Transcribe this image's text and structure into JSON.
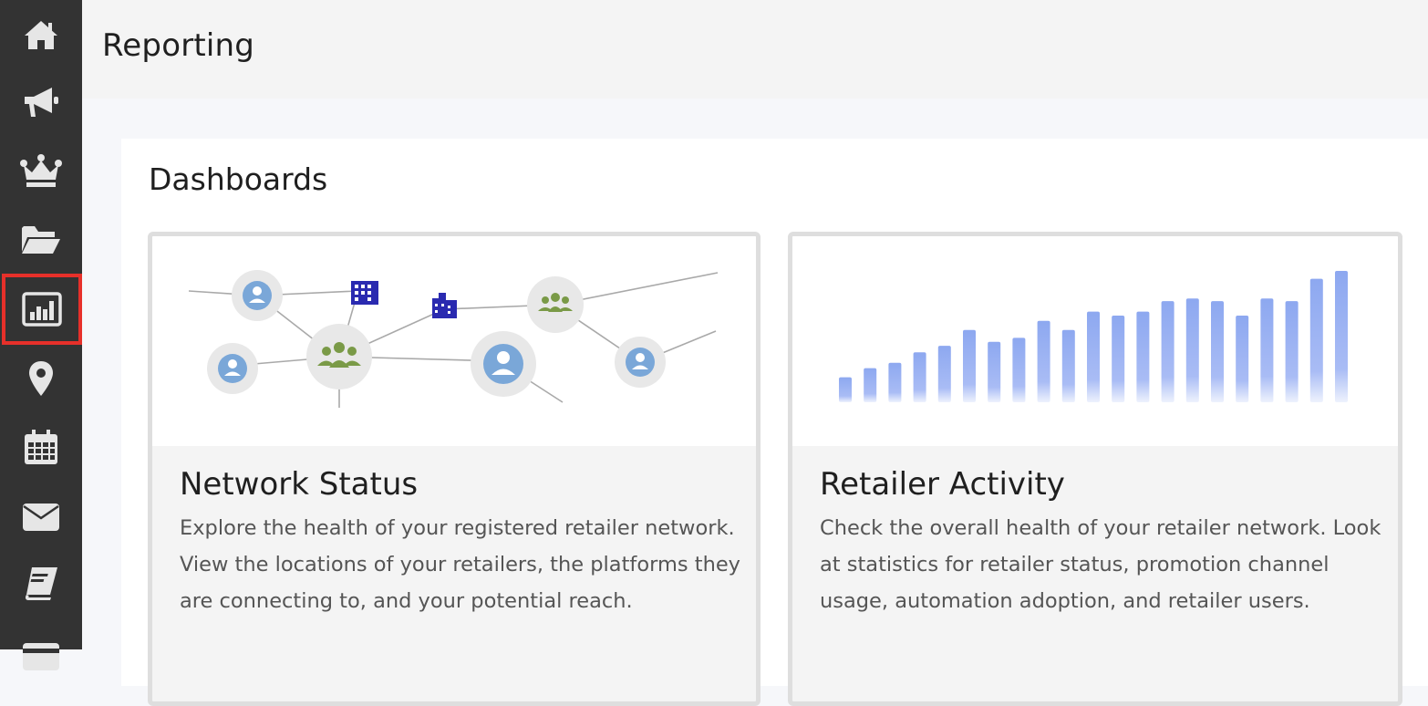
{
  "header": {
    "title": "Reporting"
  },
  "sidebar": {
    "items": [
      {
        "name": "home",
        "icon": "home-icon"
      },
      {
        "name": "campaigns",
        "icon": "megaphone-icon"
      },
      {
        "name": "loyalty",
        "icon": "crown-icon"
      },
      {
        "name": "files",
        "icon": "folder-open-icon"
      },
      {
        "name": "reporting",
        "icon": "bar-chart-icon",
        "active": true
      },
      {
        "name": "locations",
        "icon": "map-pin-icon"
      },
      {
        "name": "calendar",
        "icon": "calendar-icon"
      },
      {
        "name": "messages",
        "icon": "envelope-icon"
      },
      {
        "name": "library",
        "icon": "book-icon"
      },
      {
        "name": "billing",
        "icon": "credit-card-icon"
      }
    ],
    "active_color": "#e7302a"
  },
  "main": {
    "section_title": "Dashboards",
    "cards": [
      {
        "title": "Network Status",
        "description": "Explore the health of your registered retailer network. View the locations of your retailers, the platforms they are connecting to, and your potential reach.",
        "illustration": "network-graph"
      },
      {
        "title": "Retailer Activity",
        "description": "Check the overall health of your retailer network. Look at statistics for retailer status, promotion channel usage, automation adoption, and retailer users.",
        "illustration": "bar-chart",
        "bar_levels": [
          0.19,
          0.26,
          0.3,
          0.38,
          0.43,
          0.55,
          0.46,
          0.49,
          0.62,
          0.55,
          0.69,
          0.66,
          0.69,
          0.77,
          0.79,
          0.77,
          0.66,
          0.79,
          0.77,
          0.94,
          1.0
        ]
      }
    ]
  }
}
